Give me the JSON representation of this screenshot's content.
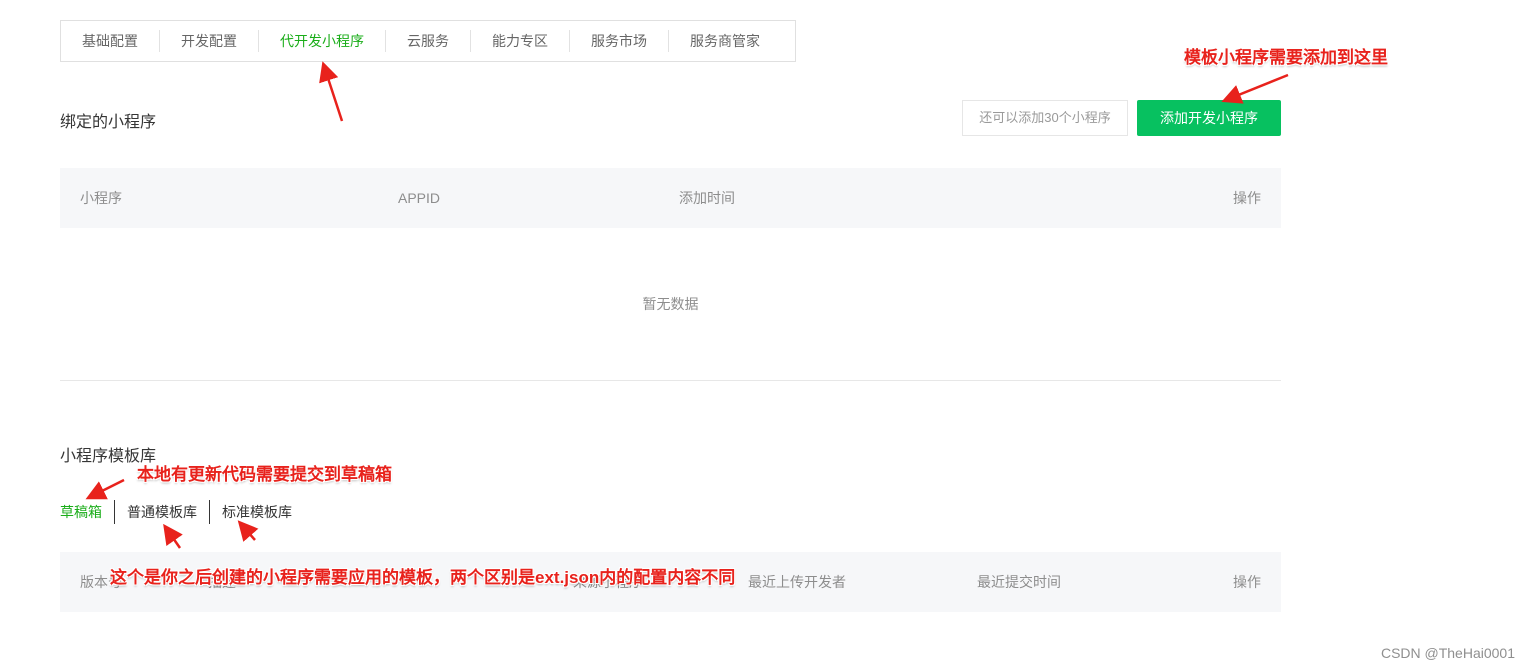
{
  "tabs": [
    {
      "label": "基础配置",
      "active": false
    },
    {
      "label": "开发配置",
      "active": false
    },
    {
      "label": "代开发小程序",
      "active": true
    },
    {
      "label": "云服务",
      "active": false
    },
    {
      "label": "能力专区",
      "active": false
    },
    {
      "label": "服务市场",
      "active": false
    },
    {
      "label": "服务商管家",
      "active": false
    }
  ],
  "bound": {
    "title": "绑定的小程序",
    "quota": "还可以添加30个小程序",
    "add_button": "添加开发小程序",
    "columns": {
      "c1": "小程序",
      "c2": "APPID",
      "c3": "添加时间",
      "c4": "操作"
    },
    "empty": "暂无数据"
  },
  "templates": {
    "title": "小程序模板库",
    "subtabs": [
      {
        "label": "草稿箱",
        "active": true
      },
      {
        "label": "普通模板库",
        "active": false
      },
      {
        "label": "标准模板库",
        "active": false
      }
    ],
    "columns": {
      "c1": "版本号",
      "c2": "描述",
      "c3": "来源小程序",
      "c4": "最近上传开发者",
      "c5": "最近提交时间",
      "c6": "操作"
    }
  },
  "annotations": {
    "add_here": "模板小程序需要添加到这里",
    "draft": "本地有更新代码需要提交到草稿箱",
    "template_diff": "这个是你之后创建的小程序需要应用的模板，两个区别是ext.json内的配置内容不同"
  },
  "watermark": "CSDN @TheHai0001",
  "colors": {
    "accent_green": "#1aad19",
    "button_green": "#07c160",
    "annotation_red": "#e8221c"
  }
}
